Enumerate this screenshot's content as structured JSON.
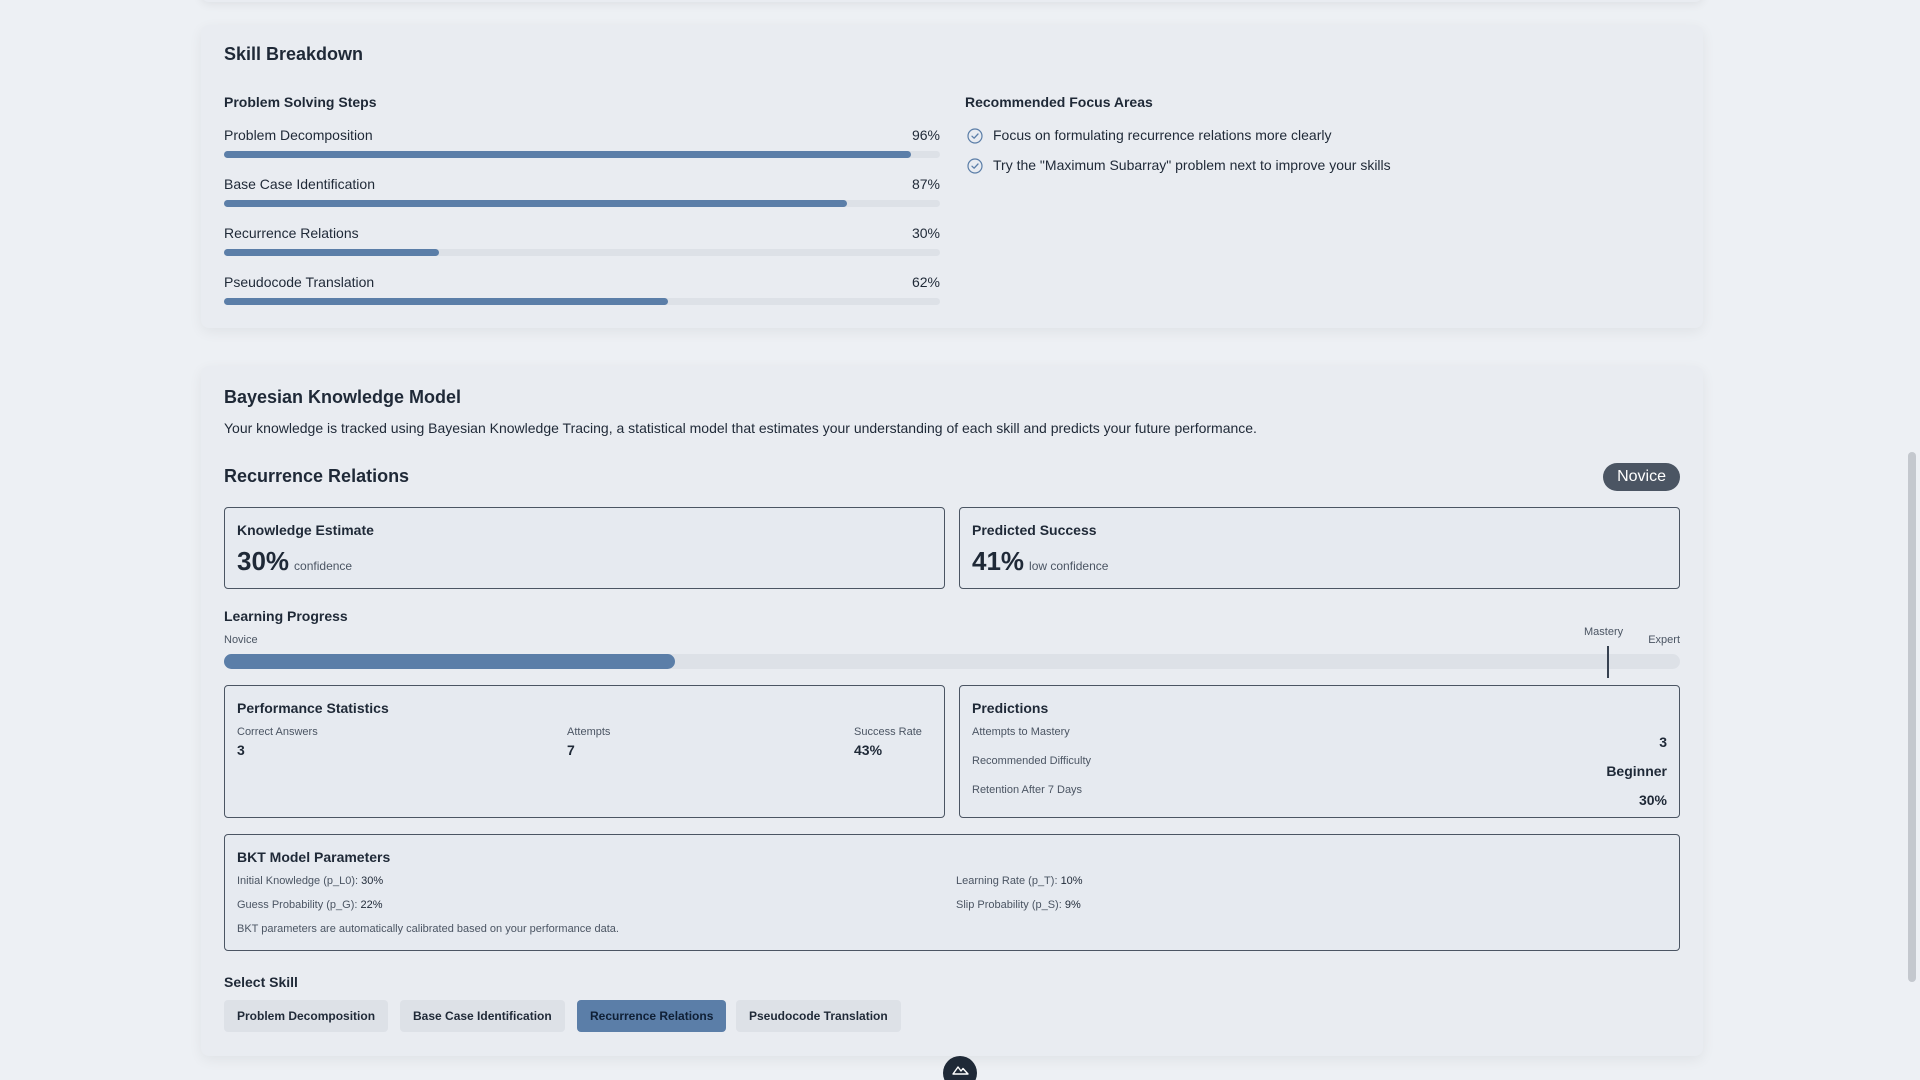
{
  "skill_breakdown": {
    "title": "Skill Breakdown",
    "steps_title": "Problem Solving Steps",
    "steps": [
      {
        "label": "Problem Decomposition",
        "percent": "96%",
        "value": 96
      },
      {
        "label": "Base Case Identification",
        "percent": "87%",
        "value": 87
      },
      {
        "label": "Recurrence Relations",
        "percent": "30%",
        "value": 30
      },
      {
        "label": "Pseudocode Translation",
        "percent": "62%",
        "value": 62
      }
    ],
    "focus_title": "Recommended Focus Areas",
    "focus_items": [
      "Focus on formulating recurrence relations more clearly",
      "Try the \"Maximum Subarray\" problem next to improve your skills"
    ]
  },
  "bkt": {
    "title": "Bayesian Knowledge Model",
    "description": "Your knowledge is tracked using Bayesian Knowledge Tracing, a statistical model that estimates your understanding of each skill and predicts your future performance.",
    "skill_name": "Recurrence Relations",
    "level_badge": "Novice",
    "knowledge": {
      "title": "Knowledge Estimate",
      "value": "30%",
      "note": "confidence"
    },
    "predicted": {
      "title": "Predicted Success",
      "value": "41%",
      "note": "low confidence"
    },
    "learning_progress": {
      "title": "Learning Progress",
      "start_label": "Novice",
      "mastery_label": "Mastery",
      "end_label": "Expert",
      "progress": 0.31
    },
    "performance": {
      "title": "Performance Statistics",
      "stats": [
        {
          "label": "Correct Answers",
          "value": "3"
        },
        {
          "label": "Attempts",
          "value": "7"
        },
        {
          "label": "Success Rate",
          "value": "43%"
        }
      ]
    },
    "predictions": {
      "title": "Predictions",
      "rows": [
        {
          "label": "Attempts to Mastery",
          "value": "3"
        },
        {
          "label": "Recommended Difficulty",
          "value": "Beginner"
        },
        {
          "label": "Retention After 7 Days",
          "value": "30%"
        }
      ]
    },
    "params": {
      "title": "BKT Model Parameters",
      "items": [
        {
          "label": "Initial Knowledge (p_L0):",
          "value": "30%"
        },
        {
          "label": "Learning Rate (p_T):",
          "value": "10%"
        },
        {
          "label": "Guess Probability (p_G):",
          "value": "22%"
        },
        {
          "label": "Slip Probability (p_S):",
          "value": "9%"
        }
      ],
      "note": "BKT parameters are automatically calibrated based on your performance data."
    },
    "select": {
      "title": "Select Skill",
      "options": [
        "Problem Decomposition",
        "Base Case Identification",
        "Recurrence Relations",
        "Pseudocode Translation"
      ],
      "selected": "Recurrence Relations"
    }
  },
  "colors": {
    "accent": "#5b7ea8",
    "badge": "#4b5563",
    "track": "#dde1e7"
  },
  "icons": {
    "focus": "check-circle-icon",
    "fab": "mountain-icon"
  }
}
